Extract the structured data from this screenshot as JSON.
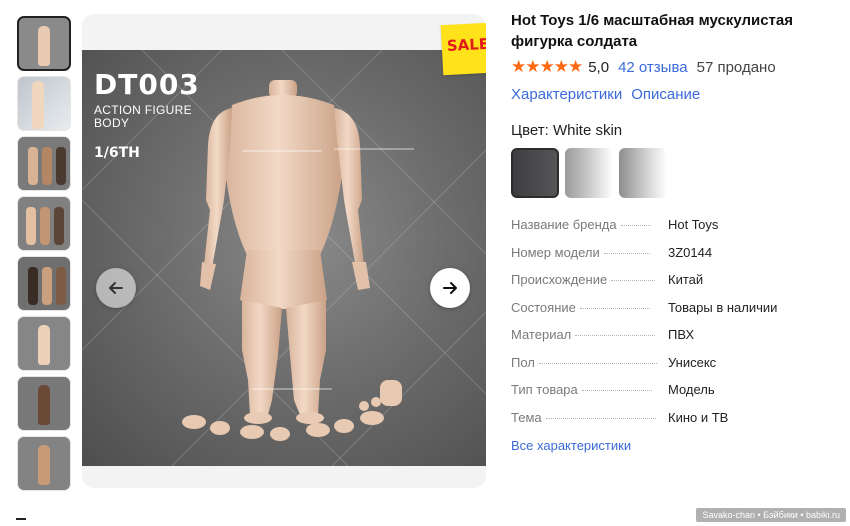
{
  "product": {
    "title": "Hot Toys 1/6 масштабная мускулистая фигурка солдата",
    "stars": "★★★★★",
    "rating": "5,0",
    "reviews": "42 отзыва",
    "sold": "57 продано"
  },
  "tabs": [
    {
      "label": "Характеристики"
    },
    {
      "label": "Описание"
    }
  ],
  "color": {
    "label": "Цвет: White skin",
    "swatches": [
      {
        "name": "dark"
      },
      {
        "name": "light1"
      },
      {
        "name": "light2"
      }
    ]
  },
  "specs": [
    {
      "key": "Название бренда",
      "value": "Hot Toys"
    },
    {
      "key": "Номер модели",
      "value": "3Z0144"
    },
    {
      "key": "Происхождение",
      "value": "Китай"
    },
    {
      "key": "Состояние",
      "value": "Товары в наличии"
    },
    {
      "key": "Материал",
      "value": "ПВХ"
    },
    {
      "key": "Пол",
      "value": "Унисекс"
    },
    {
      "key": "Тип товара",
      "value": "Модель"
    },
    {
      "key": "Тема",
      "value": "Кино и ТВ"
    }
  ],
  "all_specs_link": "Все характеристики",
  "image": {
    "title": "DT003",
    "subtitle_line1": "ACTION FIGURE",
    "subtitle_line2": "BODY",
    "scale": "1/6TH",
    "sale_badge": "SALE"
  },
  "icons": {
    "prev": "arrow-left-icon",
    "next": "arrow-right-icon"
  },
  "colors": {
    "link": "#3b6ad9",
    "stars": "#ff6a13",
    "sale_bg": "#ffe21a",
    "sale_text": "#e21b1b"
  },
  "watermark": "Savako-chan • Бэйбики • babiki.ru"
}
